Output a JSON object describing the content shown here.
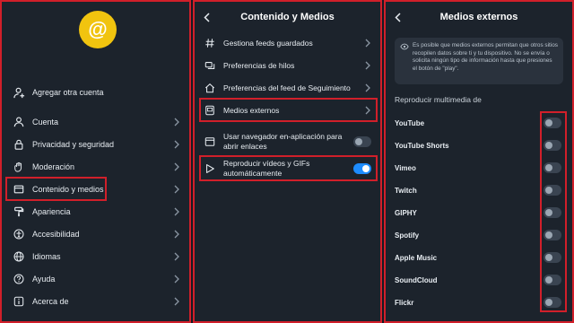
{
  "panel1": {
    "avatar_glyph": "@",
    "add_account": "Agregar otra cuenta",
    "items": [
      {
        "label": "Cuenta",
        "icon": "person-icon"
      },
      {
        "label": "Privacidad y seguridad",
        "icon": "lock-icon"
      },
      {
        "label": "Moderación",
        "icon": "hand-icon"
      },
      {
        "label": "Contenido y medios",
        "icon": "window-icon"
      },
      {
        "label": "Apariencia",
        "icon": "paint-roller-icon"
      },
      {
        "label": "Accesibilidad",
        "icon": "accessibility-icon"
      },
      {
        "label": "Idiomas",
        "icon": "globe-icon"
      },
      {
        "label": "Ayuda",
        "icon": "help-icon"
      },
      {
        "label": "Acerca de",
        "icon": "info-icon"
      }
    ]
  },
  "panel2": {
    "title": "Contenido y Medios",
    "items": [
      {
        "label": "Gestiona feeds guardados",
        "icon": "hash-icon"
      },
      {
        "label": "Preferencias de hilos",
        "icon": "threads-icon"
      },
      {
        "label": "Preferencias del feed de Seguimiento",
        "icon": "home-icon"
      },
      {
        "label": "Medios externos",
        "icon": "media-icon"
      }
    ],
    "toggles": [
      {
        "label": "Usar navegador en-aplicación para abrir enlaces",
        "icon": "browser-icon",
        "on": false
      },
      {
        "label": "Reproducir vídeos y GIFs automáticamente",
        "icon": "play-icon",
        "on": true
      }
    ]
  },
  "panel3": {
    "title": "Medios externos",
    "notice": "Es posible que medios externos permitan que otros sitios recopilen datos sobre ti y tu dispositivo. No se envía o solicita ningún tipo de información hasta que presiones el botón de \"play\".",
    "section_label": "Reproducir multimedia de",
    "sources": [
      {
        "label": "YouTube",
        "on": false
      },
      {
        "label": "YouTube Shorts",
        "on": false
      },
      {
        "label": "Vimeo",
        "on": false
      },
      {
        "label": "Twitch",
        "on": false
      },
      {
        "label": "GIPHY",
        "on": false
      },
      {
        "label": "Spotify",
        "on": false
      },
      {
        "label": "Apple Music",
        "on": false
      },
      {
        "label": "SoundCloud",
        "on": false
      },
      {
        "label": "Flickr",
        "on": false
      }
    ]
  },
  "colors": {
    "highlight": "#d11f2a",
    "accent": "#1d8cff",
    "avatar": "#f1c40f"
  }
}
